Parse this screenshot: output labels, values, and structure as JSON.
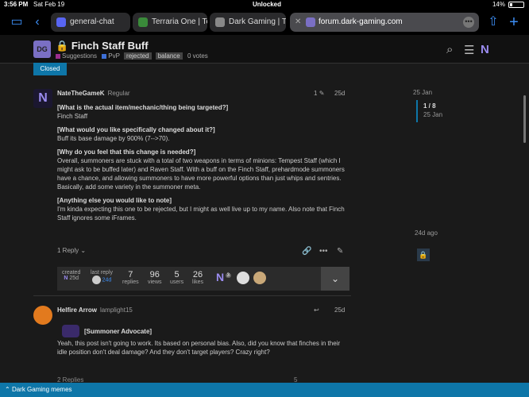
{
  "status": {
    "time": "3:56 PM",
    "date": "Sat Feb 19",
    "lock_text": "Unlocked",
    "battery": "14%"
  },
  "tabs": [
    {
      "label": "general-chat",
      "icon": "discord-icon",
      "color": "#5865f2"
    },
    {
      "label": "Terraria One | Te",
      "icon": "terraria-icon",
      "color": "#3a8a3a"
    },
    {
      "label": "Dark Gaming | Tr",
      "icon": "dark-gaming-icon",
      "color": "#888888"
    },
    {
      "label": "forum.dark-gaming.com",
      "icon": "forum-icon",
      "color": "#7a6fc4",
      "active": true
    }
  ],
  "header": {
    "logo_text": "DG",
    "title": "Finch Staff Buff",
    "category": "Suggestions",
    "subcategory": "PvP",
    "tags": [
      "rejected",
      "balance"
    ],
    "votes": "0 votes"
  },
  "closed_label": "Closed",
  "post1": {
    "username": "NateTheGameK",
    "user_title": "Regular",
    "avatar_letter": "N",
    "reply_count_marker": "1",
    "date": "25d",
    "q1": "[What is the actual item/mechanic/thing being targeted?]",
    "a1": "Finch Staff",
    "q2": "[What would you like specifically changed about it?]",
    "a2": "Buff its base damage by 900% (7-->70).",
    "q3": "[Why do you feel that this change is needed?]",
    "a3": "Overall, summoners are stuck with a total of two weapons in terms of minions: Tempest Staff (which I might ask to be buffed later) and Raven Staff. With a buff on the Finch Staff, prehardmode summoners have a chance, and allowing summoners to have more powerful options than just whips and sentries. Basically, add some variety in the summoner meta.",
    "q4": "[Anything else you would like to note]",
    "a4": "I'm kinda expecting this one to be rejected, but I might as well live up to my name. Also note that Finch Staff ignores some iFrames.",
    "reply_label": "1 Reply"
  },
  "summary": {
    "created_label": "created",
    "created_date": "25d",
    "last_reply_label": "last reply",
    "last_reply_date": "24d",
    "replies": "7",
    "replies_label": "replies",
    "views": "96",
    "views_label": "views",
    "users": "5",
    "users_label": "users",
    "likes": "26",
    "likes_label": "likes",
    "badge_count": "3"
  },
  "post2": {
    "username": "Helfire Arrow",
    "user_title": "lamplight15",
    "date": "25d",
    "quote_head": "[Summoner Advocate]",
    "text": "Yeah, this post isn't going to work. Its based on personal bias. Also, did you know that finches in their idle position don't deal damage? And they don't target players? Crazy right?",
    "replies_label": "2 Replies",
    "likes": "5"
  },
  "timeline": {
    "top_date": "25 Jan",
    "position": "1 / 8",
    "position_date": "25 Jan",
    "bottom": "24d ago"
  },
  "footer": {
    "label": "Dark Gaming memes"
  },
  "colors": {
    "accent": "#0e76a8",
    "brand": "#7a6fc4",
    "background": "#1a1a1a"
  }
}
